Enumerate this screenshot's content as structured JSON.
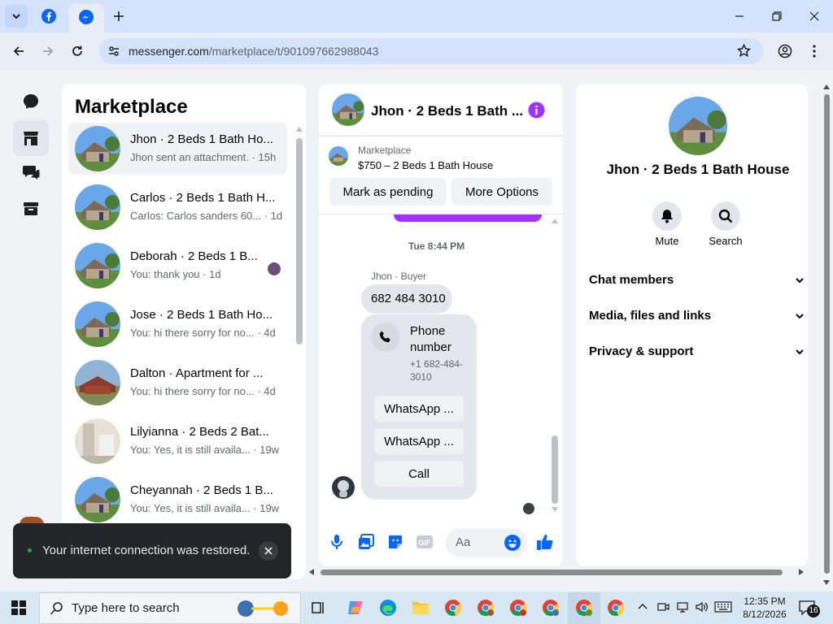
{
  "browser": {
    "url_host": "messenger.com",
    "url_path": "/marketplace/t/901097662988043"
  },
  "sidebar": {
    "title": "Marketplace",
    "conversations": [
      {
        "name": "Jhon · 2 Beds 1 Bath Ho...",
        "preview": "Jhon sent an attachment. · 15h",
        "selected": true
      },
      {
        "name": "Carlos · 2 Beds 1 Bath H...",
        "preview": "Carlos: Carlos sanders 60... · 1d"
      },
      {
        "name": "Deborah · 2 Beds 1 B...",
        "preview": "You: thank you · 1d"
      },
      {
        "name": "Jose · 2 Beds 1 Bath Ho...",
        "preview": "You: hi there sorry for no... · 4d"
      },
      {
        "name": "Dalton · Apartment for ...",
        "preview": "You: hi there sorry for no... · 4d"
      },
      {
        "name": "Lilyianna · 2 Beds 2 Bat...",
        "preview": "You: Yes, it is still availa... · 19w"
      },
      {
        "name": "Cheyannah · 2 Beds 1 B...",
        "preview": "You: Yes, it is still availa... · 19w"
      }
    ]
  },
  "chat": {
    "header_title": "Jhon · 2 Beds 1 Bath ...",
    "listing_label": "Marketplace",
    "listing_title": "$750 – 2 Beds 1 Bath House",
    "mark_pending_label": "Mark as pending",
    "more_options_label": "More Options",
    "timestamp": "Tue 8:44 PM",
    "sender_label": "Jhon · Buyer",
    "message_text": "682 484 3010",
    "contact_title": "Phone number",
    "contact_number": "+1 682-484-3010",
    "whatsapp_1": "WhatsApp ...",
    "whatsapp_2": "WhatsApp ...",
    "call_label": "Call",
    "composer_placeholder": "Aa"
  },
  "info": {
    "name": "Jhon · 2 Beds 1 Bath House",
    "mute_label": "Mute",
    "search_label": "Search",
    "sections": [
      "Chat members",
      "Media, files and links",
      "Privacy & support"
    ]
  },
  "toast": {
    "message": "Your internet connection was restored."
  },
  "taskbar": {
    "search_placeholder": "Type here to search",
    "time": "12:35 PM",
    "date": "8/12/2026",
    "notification_count": "16"
  },
  "colors": {
    "accent": "#0866ff",
    "purple": "#a033ff",
    "toast_bg": "#242526"
  }
}
